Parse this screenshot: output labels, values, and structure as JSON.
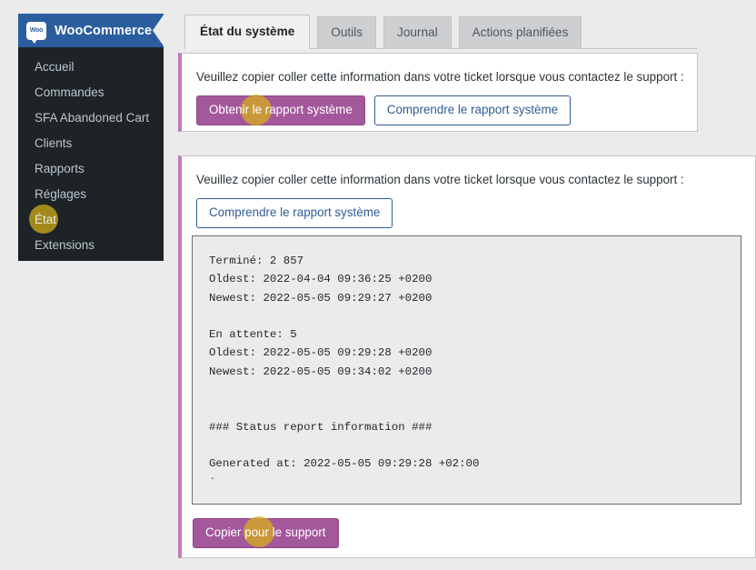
{
  "sidebar": {
    "brand": {
      "logo_text": "Woo",
      "title": "WooCommerce",
      "icon": "woocommerce-speech-bubble-icon"
    },
    "items": [
      {
        "label": "Accueil",
        "current": false
      },
      {
        "label": "Commandes",
        "current": false
      },
      {
        "label": "SFA Abandoned Cart",
        "current": false
      },
      {
        "label": "Clients",
        "current": false
      },
      {
        "label": "Rapports",
        "current": false
      },
      {
        "label": "Réglages",
        "current": false
      },
      {
        "label": "État",
        "current": true
      },
      {
        "label": "Extensions",
        "current": false
      }
    ]
  },
  "tabs": [
    {
      "label": "État du système",
      "active": true
    },
    {
      "label": "Outils",
      "active": false
    },
    {
      "label": "Journal",
      "active": false
    },
    {
      "label": "Actions planifiées",
      "active": false
    }
  ],
  "panel_top": {
    "note": "Veuillez copier coller cette information dans votre ticket lorsque vous contactez le support :",
    "primary_button": "Obtenir le rapport système",
    "secondary_button": "Comprendre le rapport système"
  },
  "panel_bottom": {
    "note": "Veuillez copier coller cette information dans votre ticket lorsque vous contactez le support :",
    "secondary_button": "Comprendre le rapport système",
    "copy_button": "Copier pour le support",
    "report_text": "Terminé: 2 857\nOldest: 2022-04-04 09:36:25 +0200\nNewest: 2022-05-05 09:29:27 +0200\n\nEn attente: 5\nOldest: 2022-05-05 09:29:28 +0200\nNewest: 2022-05-05 09:34:02 +0200\n\n\n### Status report information ###\n\nGenerated at: 2022-05-05 09:29:28 +02:00\n`"
  },
  "colors": {
    "brand_blue": "#2b5e9e",
    "sidebar_bg": "#1d2327",
    "accent_purple": "#a4589c",
    "panel_border_purple": "#c27bb8",
    "link_blue": "#2f5c94",
    "page_bg": "#ebebec",
    "click_highlight": "#d6b216"
  }
}
